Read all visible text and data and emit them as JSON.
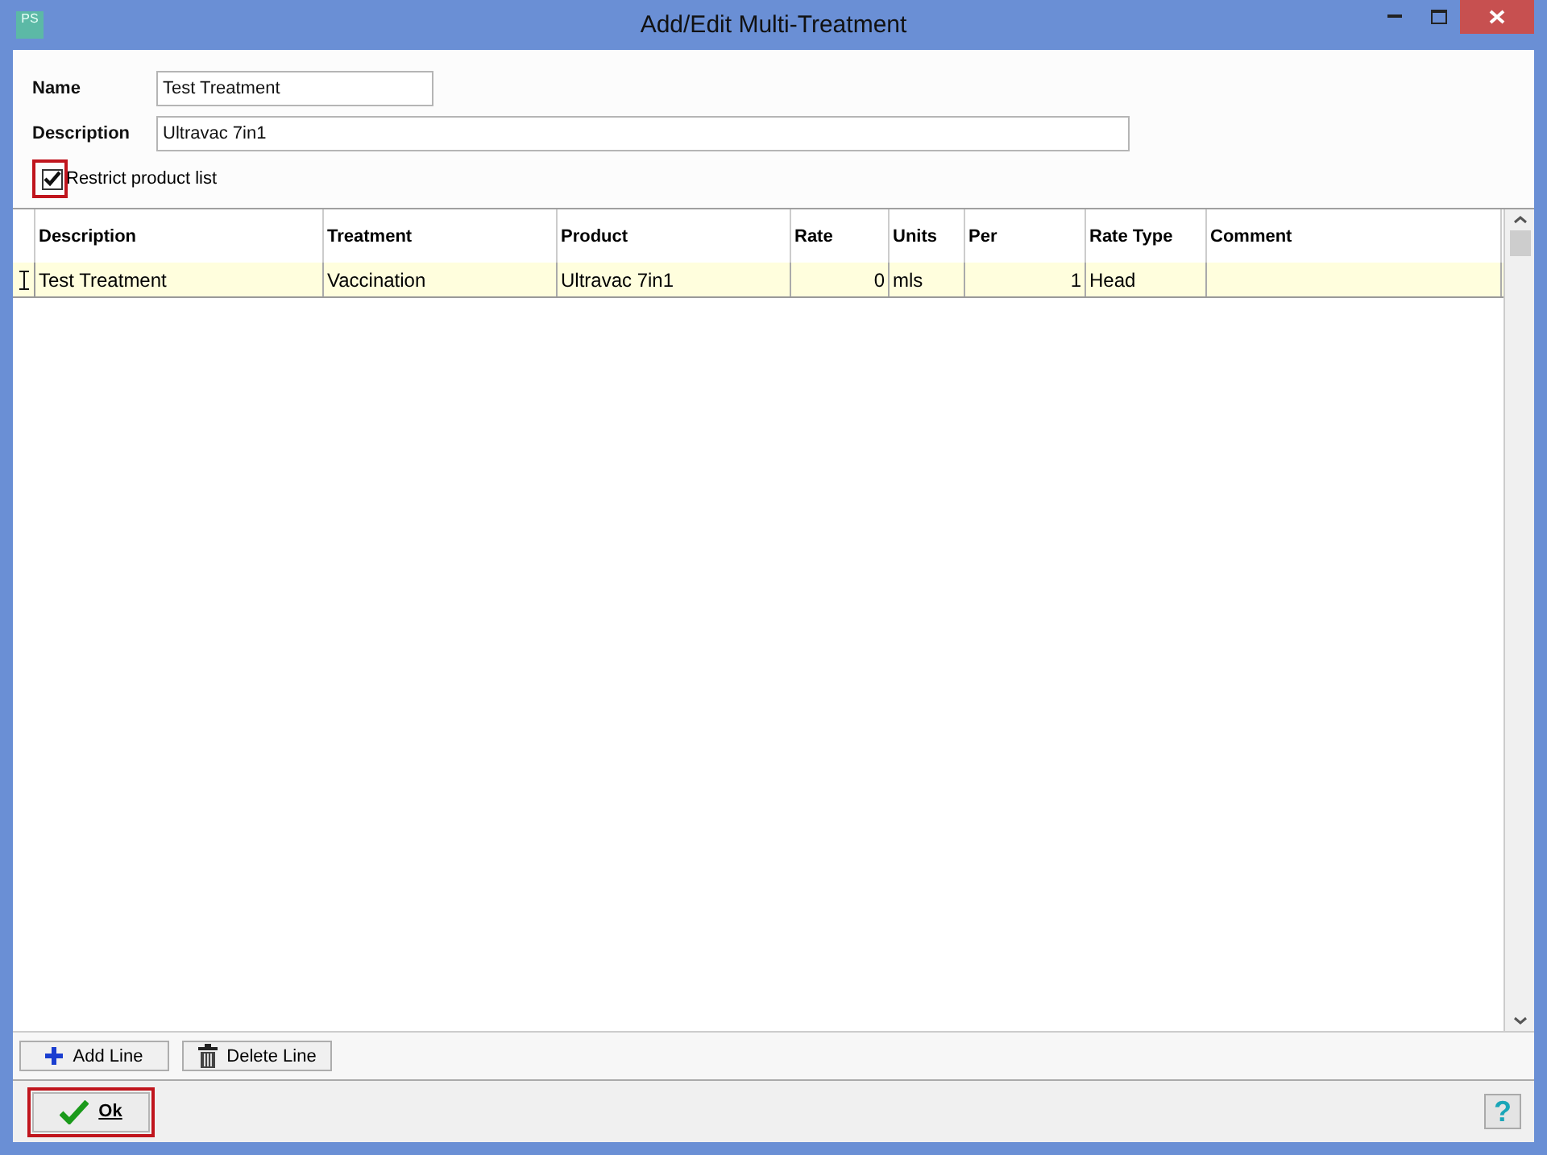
{
  "window": {
    "logo": "PS",
    "title": "Add/Edit Multi-Treatment"
  },
  "form": {
    "name_label": "Name",
    "name_value": "Test Treatment",
    "description_label": "Description",
    "description_value": "Ultravac 7in1",
    "restrict": {
      "label": "Restrict product list",
      "checked": true,
      "highlighted": true
    }
  },
  "table": {
    "columns": [
      {
        "label": "Description"
      },
      {
        "label": "Treatment"
      },
      {
        "label": "Product"
      },
      {
        "label": "Rate"
      },
      {
        "label": "Units"
      },
      {
        "label": "Per"
      },
      {
        "label": "Rate Type"
      },
      {
        "label": "Comment"
      }
    ],
    "rows": [
      {
        "current": true,
        "cells": [
          "Test Treatment",
          "Vaccination",
          "Ultravac 7in1",
          "0",
          "mls",
          "1",
          "Head",
          ""
        ]
      }
    ]
  },
  "line_buttons": [
    {
      "kind": "add",
      "label": "Add Line"
    },
    {
      "kind": "delete",
      "label": "Delete Line"
    }
  ],
  "footer": {
    "ok": {
      "label": "Ok",
      "highlighted": true
    },
    "help": "?"
  }
}
